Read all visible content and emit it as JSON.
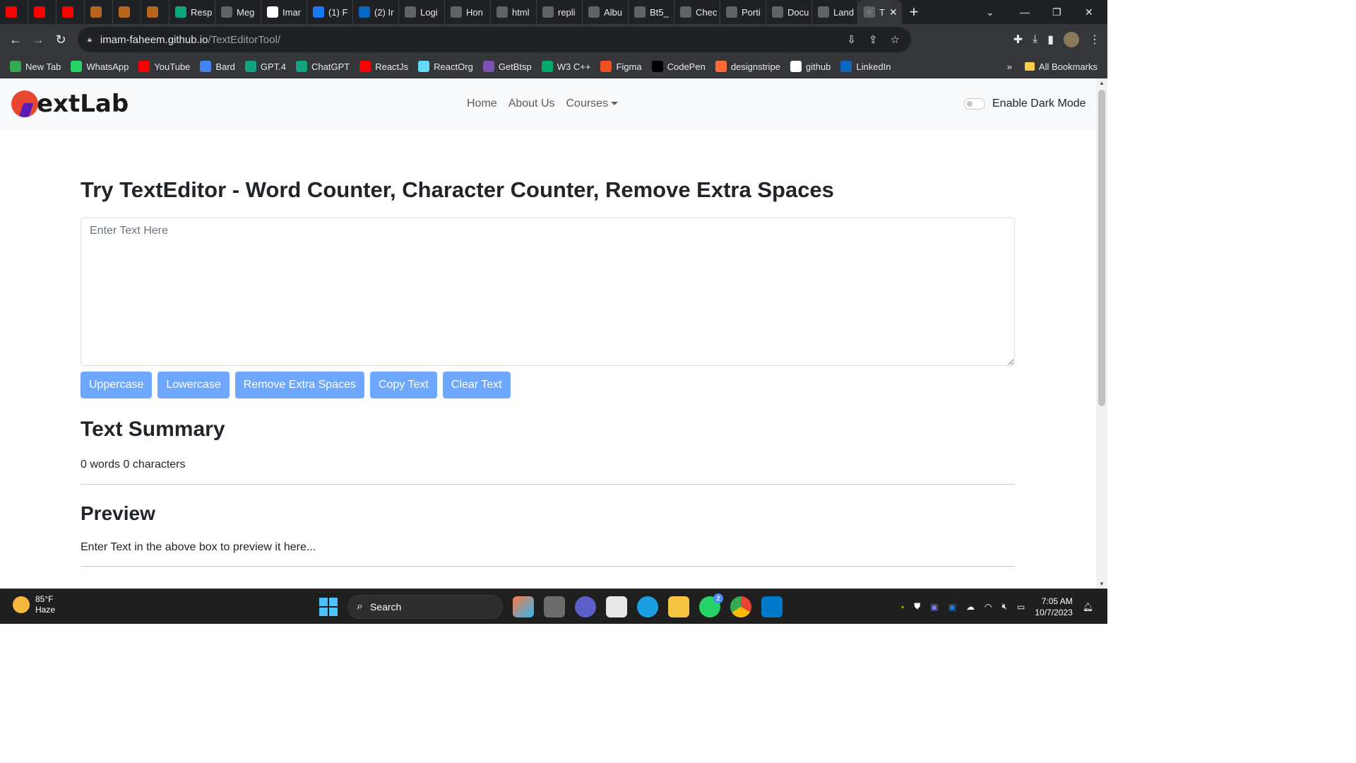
{
  "browser": {
    "tabs": [
      {
        "label": "",
        "icon": "youtube-icon",
        "color": "#ff0000"
      },
      {
        "label": "",
        "icon": "youtube-icon",
        "color": "#ff0000"
      },
      {
        "label": "",
        "icon": "youtube-icon",
        "color": "#ff0000"
      },
      {
        "label": "",
        "icon": "blogger-icon",
        "color": "#b5651d"
      },
      {
        "label": "",
        "icon": "blogger-icon",
        "color": "#b5651d"
      },
      {
        "label": "",
        "icon": "blogger-icon",
        "color": "#b5651d"
      },
      {
        "label": "Resp",
        "icon": "chatgpt-icon",
        "color": "#10a37f"
      },
      {
        "label": "Meg",
        "icon": "globe-icon",
        "color": "#5f6368"
      },
      {
        "label": "Imar",
        "icon": "github-icon",
        "color": "#ffffff"
      },
      {
        "label": "(1) F",
        "icon": "facebook-icon",
        "color": "#1877f2"
      },
      {
        "label": "(2) Ir",
        "icon": "linkedin-icon",
        "color": "#0a66c2"
      },
      {
        "label": "Logi",
        "icon": "globe-icon",
        "color": "#5f6368"
      },
      {
        "label": "Hon",
        "icon": "globe-icon",
        "color": "#5f6368"
      },
      {
        "label": "html",
        "icon": "globe-icon",
        "color": "#5f6368"
      },
      {
        "label": "repli",
        "icon": "globe-icon",
        "color": "#5f6368"
      },
      {
        "label": "Albu",
        "icon": "globe-icon",
        "color": "#5f6368"
      },
      {
        "label": "Bt5_",
        "icon": "globe-icon",
        "color": "#5f6368"
      },
      {
        "label": "Chec",
        "icon": "globe-icon",
        "color": "#5f6368"
      },
      {
        "label": "Porti",
        "icon": "globe-icon",
        "color": "#5f6368"
      },
      {
        "label": "Docu",
        "icon": "globe-icon",
        "color": "#5f6368"
      },
      {
        "label": "Land",
        "icon": "globe-icon",
        "color": "#5f6368"
      }
    ],
    "active_tab": {
      "label": "T",
      "icon": "globe-icon"
    },
    "new_tab_label": "+",
    "url_host": "imam-faheem.github.io",
    "url_path": "/TextEditorTool/",
    "bookmarks": [
      {
        "label": "New Tab",
        "icon": "chrome-icon",
        "color": "#34a853"
      },
      {
        "label": "WhatsApp",
        "icon": "whatsapp-icon",
        "color": "#25d366"
      },
      {
        "label": "YouTube",
        "icon": "youtube-icon",
        "color": "#ff0000"
      },
      {
        "label": "Bard",
        "icon": "bard-icon",
        "color": "#4285f4"
      },
      {
        "label": "GPT.4",
        "icon": "chatgpt-icon",
        "color": "#10a37f"
      },
      {
        "label": "ChatGPT",
        "icon": "chatgpt-icon",
        "color": "#10a37f"
      },
      {
        "label": "ReactJs",
        "icon": "youtube-icon",
        "color": "#ff0000"
      },
      {
        "label": "ReactOrg",
        "icon": "react-icon",
        "color": "#61dafb"
      },
      {
        "label": "GetBtsp",
        "icon": "bootstrap-icon",
        "color": "#7952b3"
      },
      {
        "label": "W3 C++",
        "icon": "w3schools-icon",
        "color": "#04aa6d"
      },
      {
        "label": "Figma",
        "icon": "figma-icon",
        "color": "#f24e1e"
      },
      {
        "label": "CodePen",
        "icon": "codepen-icon",
        "color": "#000000"
      },
      {
        "label": "designstripe",
        "icon": "designstripe-icon",
        "color": "#ff6b35"
      },
      {
        "label": "github",
        "icon": "github-icon",
        "color": "#ffffff"
      },
      {
        "label": "LinkedIn",
        "icon": "linkedin-icon",
        "color": "#0a66c2"
      }
    ],
    "bookmarks_overflow": "»",
    "all_bookmarks_label": "All Bookmarks"
  },
  "site": {
    "brand_text": "extLab",
    "nav": {
      "home": "Home",
      "about": "About Us",
      "courses": "Courses"
    },
    "dark_mode_label": "Enable Dark Mode",
    "dark_mode_enabled": false
  },
  "main": {
    "heading": "Try TextEditor - Word Counter, Character Counter, Remove Extra Spaces",
    "textarea_placeholder": "Enter Text Here",
    "textarea_value": "",
    "buttons": {
      "uppercase": "Uppercase",
      "lowercase": "Lowercase",
      "remove_spaces": "Remove Extra Spaces",
      "copy": "Copy Text",
      "clear": "Clear Text"
    },
    "button_color": "#6ea8fe",
    "summary_heading": "Text Summary",
    "summary_text": "0 words 0 characters",
    "preview_heading": "Preview",
    "preview_text": "Enter Text in the above box to preview it here..."
  },
  "taskbar": {
    "temperature": "85°F",
    "weather": "Haze",
    "search_label": "Search",
    "whatsapp_badge": "2",
    "time": "7:05 AM",
    "date": "10/7/2023"
  }
}
